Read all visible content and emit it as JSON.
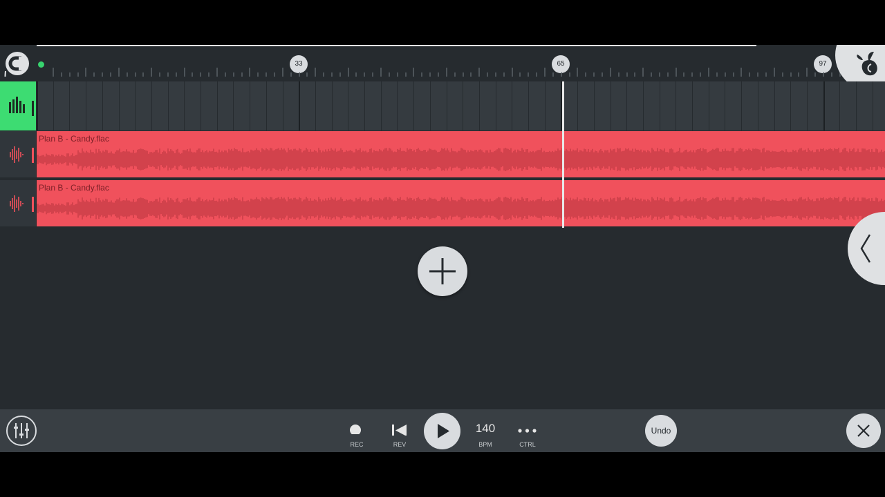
{
  "ruler": {
    "markers": [
      "33",
      "65",
      "97"
    ]
  },
  "tracks": [
    {
      "type": "pattern"
    },
    {
      "type": "audio",
      "clip_name": "Plan B - Candy.flac"
    },
    {
      "type": "audio",
      "clip_name": "Plan B - Candy.flac"
    }
  ],
  "toolbar": {
    "rec_label": "REC",
    "rev_label": "REV",
    "bpm_value": "140",
    "bpm_label": "BPM",
    "ctrl_label": "CTRL",
    "undo_label": "Undo"
  },
  "colors": {
    "accent_green": "#3ddc72",
    "clip_red": "#f0515c",
    "background": "#262b2f"
  },
  "icons": [
    "magnet-icon",
    "fl-studio-logo-icon",
    "equalizer-icon",
    "waveform-icon",
    "plus-icon",
    "chevron-left-icon",
    "mixer-icon",
    "record-icon",
    "rewind-icon",
    "play-icon",
    "more-icon",
    "close-icon"
  ]
}
